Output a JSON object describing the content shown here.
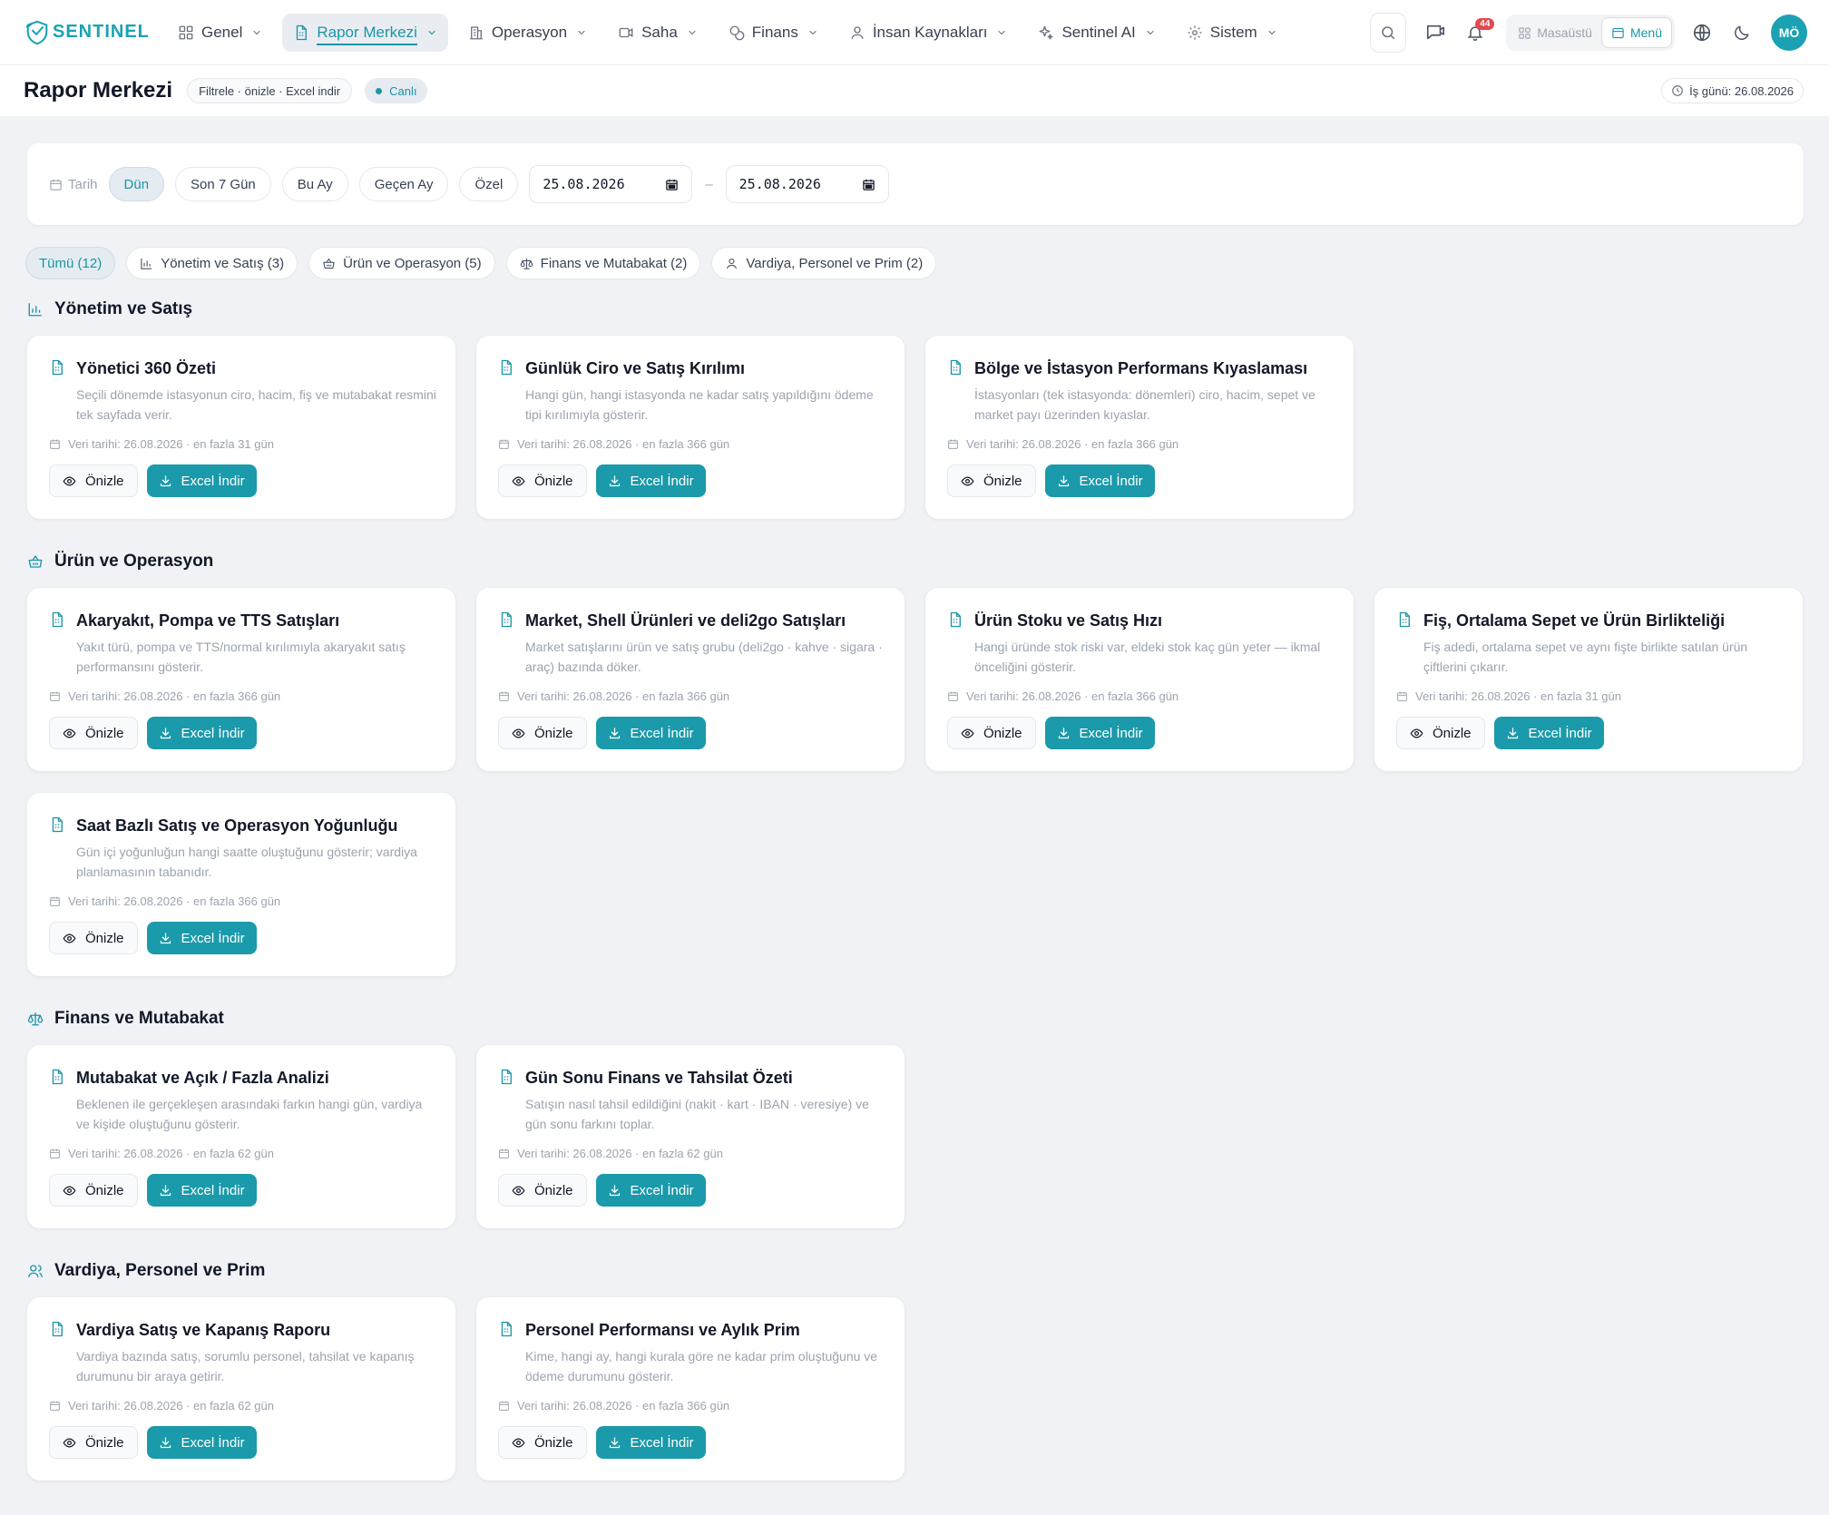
{
  "brand": {
    "name": "SENTINEL",
    "accent": "#1a9aaa"
  },
  "nav": {
    "items": [
      {
        "label": "Genel",
        "icon": "grid-icon"
      },
      {
        "label": "Rapor Merkezi",
        "icon": "document-icon"
      },
      {
        "label": "Operasyon",
        "icon": "building-icon"
      },
      {
        "label": "Saha",
        "icon": "camera-icon"
      },
      {
        "label": "Finans",
        "icon": "coins-icon"
      },
      {
        "label": "İnsan Kaynakları",
        "icon": "user-icon"
      },
      {
        "label": "Sentinel AI",
        "icon": "sparkle-icon"
      },
      {
        "label": "Sistem",
        "icon": "gear-icon"
      }
    ],
    "notification_count": "44",
    "view_desktop": "Masaüstü",
    "view_menu": "Menü",
    "avatar_initials": "MÖ"
  },
  "header": {
    "title": "Rapor Merkezi",
    "subtitle_chip": "Filtrele · önizle · Excel indir",
    "live_label": "Canlı",
    "business_day": "İş günü: 26.08.2026"
  },
  "filter": {
    "date_label": "Tarih",
    "presets": [
      "Dün",
      "Son 7 Gün",
      "Bu Ay",
      "Geçen Ay",
      "Özel"
    ],
    "selected": "Dün",
    "start_date": "25.08.2026",
    "end_date": "25.08.2026",
    "separator": "–"
  },
  "categories": [
    {
      "label": "Tümü (12)"
    },
    {
      "label": "Yönetim ve Satış (3)"
    },
    {
      "label": "Ürün ve Operasyon (5)"
    },
    {
      "label": "Finans ve Mutabakat (2)"
    },
    {
      "label": "Vardiya, Personel ve Prim (2)"
    }
  ],
  "buttons": {
    "preview": "Önizle",
    "excel": "Excel İndir"
  },
  "sections": [
    {
      "title": "Yönetim ve Satış",
      "icon": "bar-chart-icon",
      "cards": [
        {
          "title": "Yönetici 360 Özeti",
          "desc": "Seçili dönemde istasyonun ciro, hacim, fiş ve mutabakat resmini tek sayfada verir.",
          "meta": "Veri tarihi: 26.08.2026 · en fazla 31 gün"
        },
        {
          "title": "Günlük Ciro ve Satış Kırılımı",
          "desc": "Hangi gün, hangi istasyonda ne kadar satış yapıldığını ödeme tipi kırılımıyla gösterir.",
          "meta": "Veri tarihi: 26.08.2026 · en fazla 366 gün"
        },
        {
          "title": "Bölge ve İstasyon Performans Kıyaslaması",
          "desc": "İstasyonları (tek istasyonda: dönemleri) ciro, hacim, sepet ve market payı üzerinden kıyaslar.",
          "meta": "Veri tarihi: 26.08.2026 · en fazla 366 gün"
        }
      ]
    },
    {
      "title": "Ürün ve Operasyon",
      "icon": "basket-icon",
      "cards": [
        {
          "title": "Akaryakıt, Pompa ve TTS Satışları",
          "desc": "Yakıt türü, pompa ve TTS/normal kırılımıyla akaryakıt satış performansını gösterir.",
          "meta": "Veri tarihi: 26.08.2026 · en fazla 366 gün"
        },
        {
          "title": "Market, Shell Ürünleri ve deli2go Satışları",
          "desc": "Market satışlarını ürün ve satış grubu (deli2go · kahve · sigara · araç) bazında döker.",
          "meta": "Veri tarihi: 26.08.2026 · en fazla 366 gün"
        },
        {
          "title": "Ürün Stoku ve Satış Hızı",
          "desc": "Hangi üründe stok riski var, eldeki stok kaç gün yeter — ikmal önceliğini gösterir.",
          "meta": "Veri tarihi: 26.08.2026 · en fazla 366 gün"
        },
        {
          "title": "Fiş, Ortalama Sepet ve Ürün Birlikteliği",
          "desc": "Fiş adedi, ortalama sepet ve aynı fişte birlikte satılan ürün çiftlerini çıkarır.",
          "meta": "Veri tarihi: 26.08.2026 · en fazla 31 gün"
        },
        {
          "title": "Saat Bazlı Satış ve Operasyon Yoğunluğu",
          "desc": "Gün içi yoğunluğun hangi saatte oluştuğunu gösterir; vardiya planlamasının tabanıdır.",
          "meta": "Veri tarihi: 26.08.2026 · en fazla 366 gün"
        }
      ]
    },
    {
      "title": "Finans ve Mutabakat",
      "icon": "scale-icon",
      "cards": [
        {
          "title": "Mutabakat ve Açık / Fazla Analizi",
          "desc": "Beklenen ile gerçekleşen arasındaki farkın hangi gün, vardiya ve kişide oluştuğunu gösterir.",
          "meta": "Veri tarihi: 26.08.2026 · en fazla 62 gün"
        },
        {
          "title": "Gün Sonu Finans ve Tahsilat Özeti",
          "desc": "Satışın nasıl tahsil edildiğini (nakit · kart · IBAN · veresiye) ve gün sonu farkını toplar.",
          "meta": "Veri tarihi: 26.08.2026 · en fazla 62 gün"
        }
      ]
    },
    {
      "title": "Vardiya, Personel ve Prim",
      "icon": "users-icon",
      "cards": [
        {
          "title": "Vardiya Satış ve Kapanış Raporu",
          "desc": "Vardiya bazında satış, sorumlu personel, tahsilat ve kapanış durumunu bir araya getirir.",
          "meta": "Veri tarihi: 26.08.2026 · en fazla 62 gün"
        },
        {
          "title": "Personel Performansı ve Aylık Prim",
          "desc": "Kime, hangi ay, hangi kurala göre ne kadar prim oluştuğunu ve ödeme durumunu gösterir.",
          "meta": "Veri tarihi: 26.08.2026 · en fazla 366 gün"
        }
      ]
    }
  ]
}
